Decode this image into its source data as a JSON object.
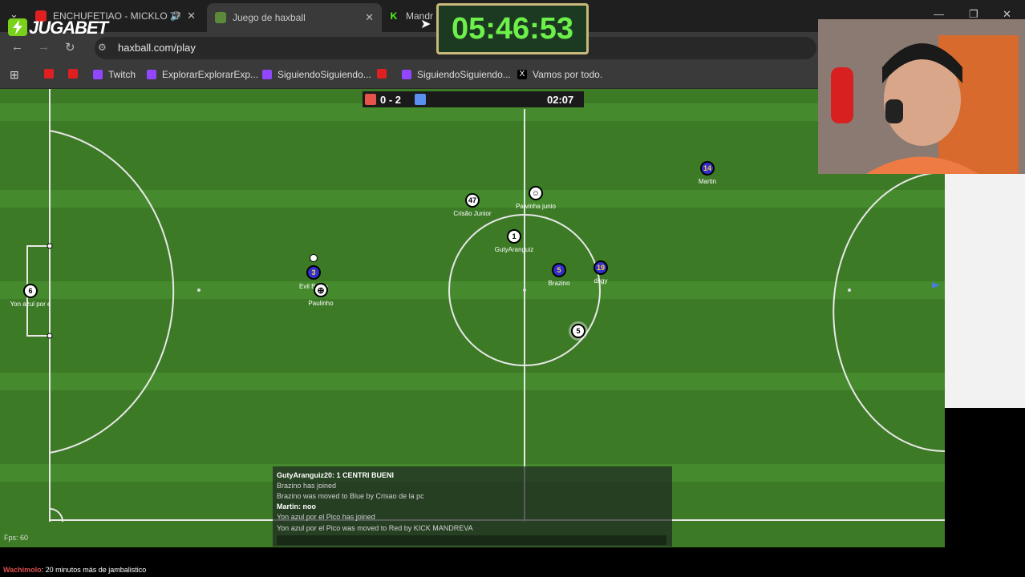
{
  "browser": {
    "tabs": [
      {
        "label": "ENCHUFETIAO - MICKLO 77",
        "icon": "youtube-icon"
      },
      {
        "label": "Juego de haxball",
        "icon": "haxball-icon"
      },
      {
        "label": "Mandr",
        "icon": "kick-icon"
      }
    ],
    "url": "haxball.com/play",
    "bookmarks": [
      {
        "label": "",
        "icon": "youtube-icon"
      },
      {
        "label": "",
        "icon": "youtube-icon"
      },
      {
        "label": "Twitch",
        "icon": "twitch-icon"
      },
      {
        "label": "ExplorarExplorarExp...",
        "icon": "twitch-icon"
      },
      {
        "label": "SiguiendoSiguiendo...",
        "icon": "twitch-icon"
      },
      {
        "label": "",
        "icon": "youtube-icon"
      },
      {
        "label": "SiguiendoSiguiendo...",
        "icon": "twitch-icon"
      },
      {
        "label": "Vamos por todo.",
        "icon": "x-icon"
      }
    ]
  },
  "overlay": {
    "sponsor": "JUGABET",
    "timer": "05:46:53"
  },
  "game": {
    "score": "0 - 2",
    "clock": "02:07",
    "fps": "Fps: 60",
    "players": [
      {
        "number": "6",
        "name": "Yon azul por e",
        "team": "white"
      },
      {
        "number": "3",
        "name": "Evil Be  an",
        "team": "blue"
      },
      {
        "number": "",
        "name": "Paulinho",
        "team": "white"
      },
      {
        "number": "47",
        "name": "Crisão Junior",
        "team": "white"
      },
      {
        "number": "",
        "name": "Paivinha junio",
        "team": "white"
      },
      {
        "number": "1",
        "name": "GutyAranguiz",
        "team": "white"
      },
      {
        "number": "5",
        "name": "Brazino",
        "team": "blue"
      },
      {
        "number": "19",
        "name": "dsgy",
        "team": "blue"
      },
      {
        "number": "5",
        "name": "",
        "team": "white"
      },
      {
        "number": "14",
        "name": "Martin",
        "team": "blue"
      }
    ]
  },
  "chat": [
    {
      "user": "GutyAranguiz20",
      "text": ": 1 CENTRI BUENI"
    },
    {
      "user": "",
      "text": "Brazino has joined"
    },
    {
      "user": "",
      "text": "Brazino was moved to Blue by Crisao de la pc"
    },
    {
      "user": "Martin",
      "text": ": noo"
    },
    {
      "user": "",
      "text": "Yon azul por el Pico has joined"
    },
    {
      "user": "",
      "text": "Yon azul por el Pico was moved to Red by KICK MANDREVA"
    }
  ],
  "ticker": {
    "user": "Wachimolo",
    "text": ": 20 minutos más de jambalistico"
  }
}
